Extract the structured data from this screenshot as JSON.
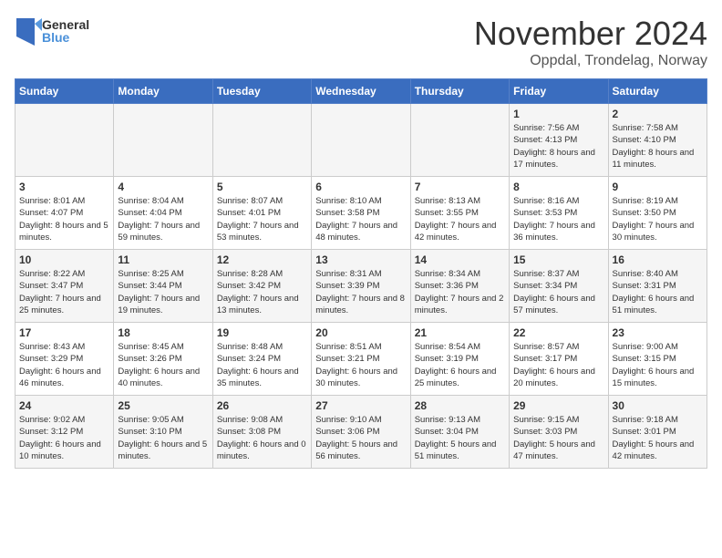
{
  "logo": {
    "general": "General",
    "blue": "Blue"
  },
  "title": {
    "month": "November 2024",
    "location": "Oppdal, Trondelag, Norway"
  },
  "weekdays": [
    "Sunday",
    "Monday",
    "Tuesday",
    "Wednesday",
    "Thursday",
    "Friday",
    "Saturday"
  ],
  "weeks": [
    [
      {
        "day": "",
        "info": ""
      },
      {
        "day": "",
        "info": ""
      },
      {
        "day": "",
        "info": ""
      },
      {
        "day": "",
        "info": ""
      },
      {
        "day": "",
        "info": ""
      },
      {
        "day": "1",
        "info": "Sunrise: 7:56 AM\nSunset: 4:13 PM\nDaylight: 8 hours and 17 minutes."
      },
      {
        "day": "2",
        "info": "Sunrise: 7:58 AM\nSunset: 4:10 PM\nDaylight: 8 hours and 11 minutes."
      }
    ],
    [
      {
        "day": "3",
        "info": "Sunrise: 8:01 AM\nSunset: 4:07 PM\nDaylight: 8 hours and 5 minutes."
      },
      {
        "day": "4",
        "info": "Sunrise: 8:04 AM\nSunset: 4:04 PM\nDaylight: 7 hours and 59 minutes."
      },
      {
        "day": "5",
        "info": "Sunrise: 8:07 AM\nSunset: 4:01 PM\nDaylight: 7 hours and 53 minutes."
      },
      {
        "day": "6",
        "info": "Sunrise: 8:10 AM\nSunset: 3:58 PM\nDaylight: 7 hours and 48 minutes."
      },
      {
        "day": "7",
        "info": "Sunrise: 8:13 AM\nSunset: 3:55 PM\nDaylight: 7 hours and 42 minutes."
      },
      {
        "day": "8",
        "info": "Sunrise: 8:16 AM\nSunset: 3:53 PM\nDaylight: 7 hours and 36 minutes."
      },
      {
        "day": "9",
        "info": "Sunrise: 8:19 AM\nSunset: 3:50 PM\nDaylight: 7 hours and 30 minutes."
      }
    ],
    [
      {
        "day": "10",
        "info": "Sunrise: 8:22 AM\nSunset: 3:47 PM\nDaylight: 7 hours and 25 minutes."
      },
      {
        "day": "11",
        "info": "Sunrise: 8:25 AM\nSunset: 3:44 PM\nDaylight: 7 hours and 19 minutes."
      },
      {
        "day": "12",
        "info": "Sunrise: 8:28 AM\nSunset: 3:42 PM\nDaylight: 7 hours and 13 minutes."
      },
      {
        "day": "13",
        "info": "Sunrise: 8:31 AM\nSunset: 3:39 PM\nDaylight: 7 hours and 8 minutes."
      },
      {
        "day": "14",
        "info": "Sunrise: 8:34 AM\nSunset: 3:36 PM\nDaylight: 7 hours and 2 minutes."
      },
      {
        "day": "15",
        "info": "Sunrise: 8:37 AM\nSunset: 3:34 PM\nDaylight: 6 hours and 57 minutes."
      },
      {
        "day": "16",
        "info": "Sunrise: 8:40 AM\nSunset: 3:31 PM\nDaylight: 6 hours and 51 minutes."
      }
    ],
    [
      {
        "day": "17",
        "info": "Sunrise: 8:43 AM\nSunset: 3:29 PM\nDaylight: 6 hours and 46 minutes."
      },
      {
        "day": "18",
        "info": "Sunrise: 8:45 AM\nSunset: 3:26 PM\nDaylight: 6 hours and 40 minutes."
      },
      {
        "day": "19",
        "info": "Sunrise: 8:48 AM\nSunset: 3:24 PM\nDaylight: 6 hours and 35 minutes."
      },
      {
        "day": "20",
        "info": "Sunrise: 8:51 AM\nSunset: 3:21 PM\nDaylight: 6 hours and 30 minutes."
      },
      {
        "day": "21",
        "info": "Sunrise: 8:54 AM\nSunset: 3:19 PM\nDaylight: 6 hours and 25 minutes."
      },
      {
        "day": "22",
        "info": "Sunrise: 8:57 AM\nSunset: 3:17 PM\nDaylight: 6 hours and 20 minutes."
      },
      {
        "day": "23",
        "info": "Sunrise: 9:00 AM\nSunset: 3:15 PM\nDaylight: 6 hours and 15 minutes."
      }
    ],
    [
      {
        "day": "24",
        "info": "Sunrise: 9:02 AM\nSunset: 3:12 PM\nDaylight: 6 hours and 10 minutes."
      },
      {
        "day": "25",
        "info": "Sunrise: 9:05 AM\nSunset: 3:10 PM\nDaylight: 6 hours and 5 minutes."
      },
      {
        "day": "26",
        "info": "Sunrise: 9:08 AM\nSunset: 3:08 PM\nDaylight: 6 hours and 0 minutes."
      },
      {
        "day": "27",
        "info": "Sunrise: 9:10 AM\nSunset: 3:06 PM\nDaylight: 5 hours and 56 minutes."
      },
      {
        "day": "28",
        "info": "Sunrise: 9:13 AM\nSunset: 3:04 PM\nDaylight: 5 hours and 51 minutes."
      },
      {
        "day": "29",
        "info": "Sunrise: 9:15 AM\nSunset: 3:03 PM\nDaylight: 5 hours and 47 minutes."
      },
      {
        "day": "30",
        "info": "Sunrise: 9:18 AM\nSunset: 3:01 PM\nDaylight: 5 hours and 42 minutes."
      }
    ]
  ]
}
